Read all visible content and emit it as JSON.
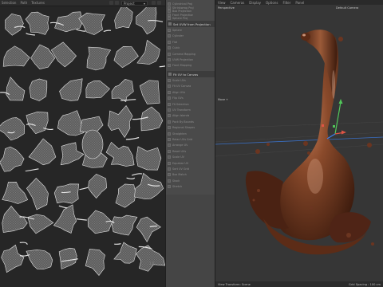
{
  "uv_editor": {
    "menu": [
      "Selection",
      "Path",
      "Textures"
    ],
    "projection_mode": "Project",
    "corner_number": "1.0"
  },
  "tool_panel": {
    "top_items": [
      "Cylindrical Proj",
      "Shrinkwrap Proj",
      "Box Projection",
      "Front Projection",
      "Sphere Proj"
    ],
    "projection_header": "Set UVW from Projection",
    "projection_items": [
      "Sphere",
      "Cylinder",
      "Flat",
      "Cubic",
      "Camera Mapping",
      "UVW Projection",
      "Front Mapping"
    ],
    "camera_header": "Fit UV to Canvas",
    "lower_items": [
      "Scale UVs",
      "Fit UV Canvas",
      "Align UVs",
      "Flip UVs",
      "Fit Selection",
      "UV Transform",
      "Align Islands",
      "Pack By Bounds",
      "Regional Shapes",
      "Straighten",
      "Relax UVs Grid",
      "Arrange UV",
      "Reset UVs",
      "Scale UV",
      "Equalize UV",
      "Sort UV Grid",
      "Box Match",
      "Stack",
      "Stretch"
    ]
  },
  "viewport": {
    "menu": [
      "View",
      "Cameras",
      "Display",
      "Options",
      "Filter",
      "Panel"
    ],
    "view_name": "Perspective",
    "camera_name": "Default Camera",
    "axis_label": "Move +",
    "status_left": "View Transform: Scene",
    "status_right": "Grid Spacing : 100 cm"
  },
  "colors": {
    "accent": "#3b7fd4",
    "object": "#6e3a22",
    "axis_x": "#e05545",
    "axis_y": "#51c75a",
    "axis_z": "#3a7ff0"
  },
  "icons": [
    "hamburger-icon",
    "zoom-icon",
    "lock-icon",
    "chevron-down-icon",
    "camera-icon",
    "gizmo-icon"
  ]
}
